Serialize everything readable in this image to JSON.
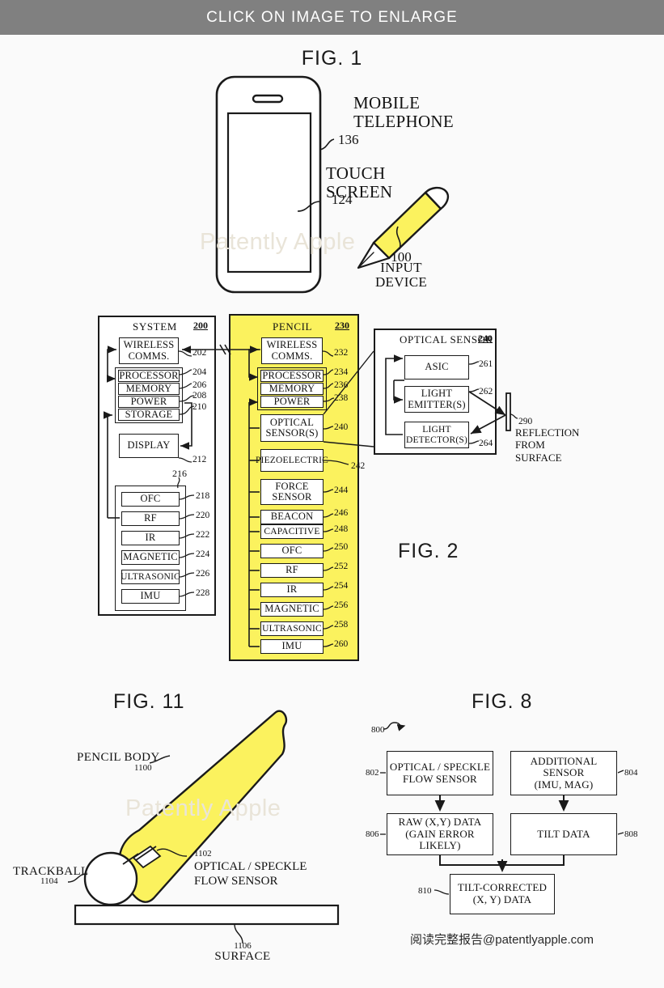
{
  "banner": {
    "text": "CLICK ON IMAGE TO ENLARGE"
  },
  "watermarks": {
    "fig1": "Patently Apple",
    "fig11": "Patently Apple"
  },
  "footer": {
    "credit": "阅读完整报告@patentlyapple.com"
  },
  "figures": {
    "fig1": {
      "title": "FIG. 1",
      "labels": {
        "mobile_telephone": "MOBILE\nTELEPHONE",
        "mobile_telephone_line1": "MOBILE",
        "mobile_telephone_line2": "TELEPHONE",
        "mobile_telephone_ref": "136",
        "touch_screen_line1": "TOUCH",
        "touch_screen_line2": "SCREEN",
        "touch_screen_ref": "124",
        "input_device_ref": "100",
        "input_device_line1": "INPUT",
        "input_device_line2": "DEVICE"
      }
    },
    "fig2": {
      "title": "FIG. 2",
      "system": {
        "title": "SYSTEM",
        "ref": "200",
        "blocks": [
          {
            "label": "WIRELESS\nCOMMS.",
            "ref": "202"
          },
          {
            "label": "PROCESSOR",
            "ref": "204"
          },
          {
            "label": "MEMORY",
            "ref": "206"
          },
          {
            "label": "POWER",
            "ref": "208"
          },
          {
            "label": "STORAGE",
            "ref": "210"
          },
          {
            "label": "DISPLAY",
            "ref": "212"
          },
          {
            "label": "OFC",
            "ref": "218"
          },
          {
            "label": "RF",
            "ref": "220"
          },
          {
            "label": "IR",
            "ref": "222"
          },
          {
            "label": "MAGNETIC",
            "ref": "224"
          },
          {
            "label": "ULTRASONIC",
            "ref": "226"
          },
          {
            "label": "IMU",
            "ref": "228"
          }
        ],
        "sensor_group_ref": "216"
      },
      "pencil": {
        "title": "PENCIL",
        "ref": "230",
        "blocks": [
          {
            "label": "WIRELESS\nCOMMS.",
            "ref": "232"
          },
          {
            "label": "PROCESSOR",
            "ref": "234"
          },
          {
            "label": "MEMORY",
            "ref": "236"
          },
          {
            "label": "POWER",
            "ref": "238"
          },
          {
            "label": "OPTICAL\nSENSOR(S)",
            "ref": "240"
          },
          {
            "label": "PIEZOELECTRIC",
            "ref": "242"
          },
          {
            "label": "FORCE\nSENSOR",
            "ref": "244"
          },
          {
            "label": "BEACON",
            "ref": "246"
          },
          {
            "label": "CAPACITIVE",
            "ref": "248"
          },
          {
            "label": "OFC",
            "ref": "250"
          },
          {
            "label": "RF",
            "ref": "252"
          },
          {
            "label": "IR",
            "ref": "254"
          },
          {
            "label": "MAGNETIC",
            "ref": "256"
          },
          {
            "label": "ULTRASONIC",
            "ref": "258"
          },
          {
            "label": "IMU",
            "ref": "260"
          }
        ]
      },
      "optical_sensor": {
        "title": "OPTICAL SENSOR",
        "ref": "240",
        "blocks": [
          {
            "label": "ASIC",
            "ref": "261"
          },
          {
            "label": "LIGHT\nEMITTER(S)",
            "ref": "262"
          },
          {
            "label": "LIGHT\nDETECTOR(S)",
            "ref": "264"
          }
        ],
        "reflection_ref": "290",
        "reflection_line1": "REFLECTION",
        "reflection_line2": "FROM",
        "reflection_line3": "SURFACE"
      }
    },
    "fig11": {
      "title": "FIG. 11",
      "labels": {
        "pencil_body": "PENCIL BODY",
        "pencil_body_ref": "1100",
        "trackball": "TRACKBALL",
        "trackball_ref": "1104",
        "flow_sensor_ref": "1102",
        "flow_sensor_line1": "OPTICAL / SPECKLE",
        "flow_sensor_line2": "FLOW SENSOR",
        "surface_ref": "1106",
        "surface": "SURFACE"
      }
    },
    "fig8": {
      "title": "FIG. 8",
      "flow_ref": "800",
      "blocks": [
        {
          "ref": "802",
          "line1": "OPTICAL / SPECKLE",
          "line2": "FLOW SENSOR"
        },
        {
          "ref": "804",
          "line1": "ADDITIONAL SENSOR",
          "line2": "(IMU, MAG)"
        },
        {
          "ref": "806",
          "line1": "RAW (X,Y) DATA",
          "line2": "(GAIN ERROR LIKELY)"
        },
        {
          "ref": "808",
          "line1": "TILT DATA",
          "line2": ""
        },
        {
          "ref": "810",
          "line1": "TILT-CORRECTED",
          "line2": "(X, Y) DATA"
        }
      ]
    }
  },
  "colors": {
    "banner_bg": "#808080",
    "pencil_yellow": "#fbf25e",
    "ink": "#1a1a1a",
    "page_bg": "#fafafa"
  }
}
